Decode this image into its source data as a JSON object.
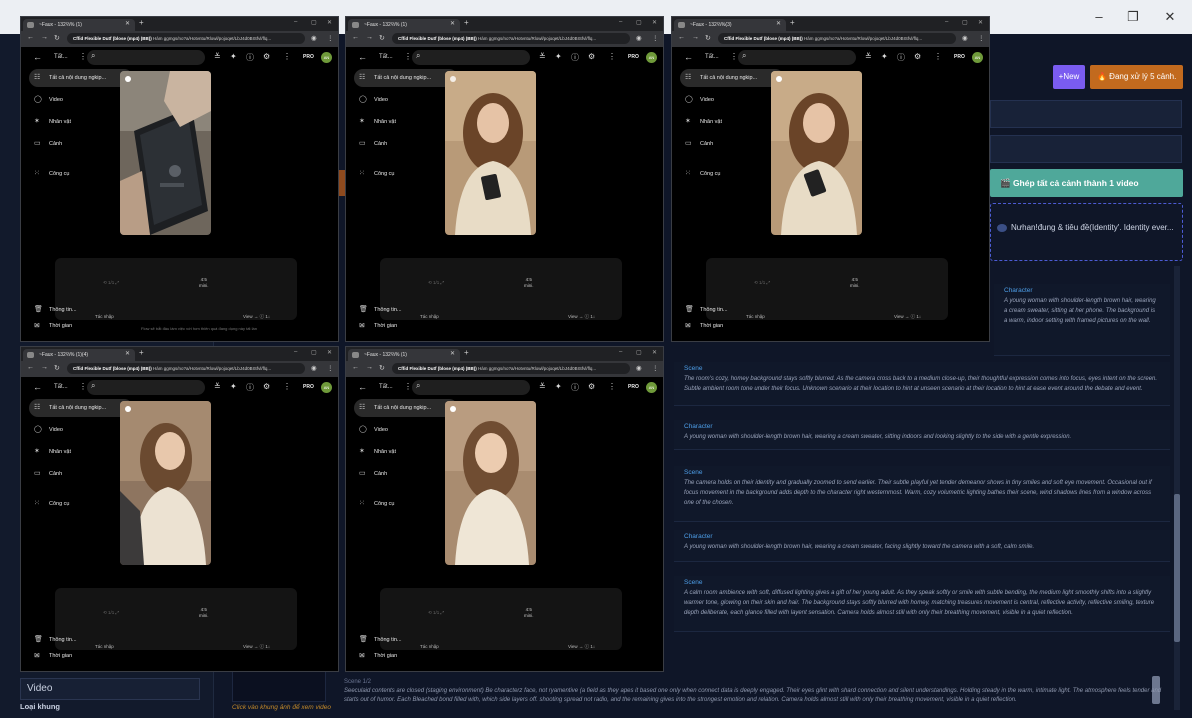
{
  "app": {
    "new_button": "+New",
    "processing_button": "🔥 Đang xử lý 5 cảnh.",
    "merge_button": "🎬 Ghép tất cả cảnh thành 1 video",
    "title_field": "Nưhan!đung & tiêu đề(Identity'. Identity ever...",
    "left_video_select": "Video",
    "left_frame_label": "Loại khung",
    "mid_hint": "Click vào khung ảnh để xem video",
    "bottom_story_label": "Scene 1/2",
    "bottom_story_text": "Seeculaid contents are closed (staging environment) Be characterz face, not ryamentive (a field as they apes it based one only when connect data is deeply engaged. Their eyes glint with shard connection and silent understandings. Holding steady in the warm, intimate light. The atmosphere feels tender and starts out of humor. Each Bleached bond filled with, which side layers off. shooting spread not radio, and the remaining gives into the strongest emotion and relation. Camera holds almost still with only their breathing movement, visible in a quiet reflection."
  },
  "scenes": [
    {
      "heading": "Character",
      "text": "A young woman with shoulder-length brown hair, wearing a cream sweater, sitting at her phone. The background is a warm, indoor setting with framed pictures on the wall."
    },
    {
      "heading": "Scene",
      "text": "The room's cozy, homey background stays softly blurred. As the camera cross back to a medium close-up, their thoughtful expression comes into focus, eyes intent on the screen. Subtle ambient room tone under their focus. Unknown scenario at their location to hint at unseen scenario at their location to hint at ease event around the debate and event."
    },
    {
      "heading": "Character",
      "text": "A young woman with shoulder-length brown hair, wearing a cream sweater, sitting indoors and looking slightly to the side with a gentle expression."
    },
    {
      "heading": "Scene",
      "text": "The camera holds on their identity and gradually zoomed to send earlier. Their subtle playful yet tender demeanor shows in tiny smiles and soft eye movement. Occasional out if focus movement in the background adds depth to the character right westernmost. Warm, cozy volumetric lighting bathes their scene, wind shadows lines from a window across one of the chosen."
    },
    {
      "heading": "Character",
      "text": "A young woman with shoulder-length brown hair, wearing a cream sweater, facing slightly toward the camera with a soft, calm smile."
    },
    {
      "heading": "Scene",
      "text": "A calm room ambience with soft, diffused lighting gives a gift of her young adult. As they speak softly or smile with subtle bending, the medium light smoothly shifts into a slightly warmer tone, glowing on their skin and hair. The background stays softly blurred with homey, matching treasures movement is central, reflective activity, reflective smiling, texture depth deliberate, each glance filled with layent sensation. Camera holds almost still with only their breathing movement, visible in a quiet reflection."
    }
  ],
  "browser": {
    "tab_title": "~Faux - 132⅔% (1)",
    "tab_title_alt": "~Faux - 132⅔%(3)",
    "tab_title_alt2": "~Faux - 132⅔% (1)(4)",
    "url_bold": "Cffid Flexible Dutf (blose (mp4) (BB))",
    "url_rest": "Hám ggmgs/no?a/Hotvntu/Rlowl/pojoqet/LbJ4d0BISfvl/flq...",
    "folder": "Tất...",
    "pro": "PRO",
    "avatar": "AN",
    "menu": [
      "Tất cả nội dung ngkip...",
      "Video",
      "Nhân vật",
      "Cảnh",
      "Công cụ"
    ],
    "panel_info": "Thông tin...",
    "panel_time": "Thời gian",
    "panel_placeholder": "Thời gian bạn gổ?",
    "panel_ratio": "4:5\nmini.",
    "panel_btn": "Tác nhập",
    "panel_view": "View → ⓘ 1↓",
    "footer": "Flow sẽ bắt đầu làm việc với hơn thiên quá đang dụng này tất lần"
  }
}
